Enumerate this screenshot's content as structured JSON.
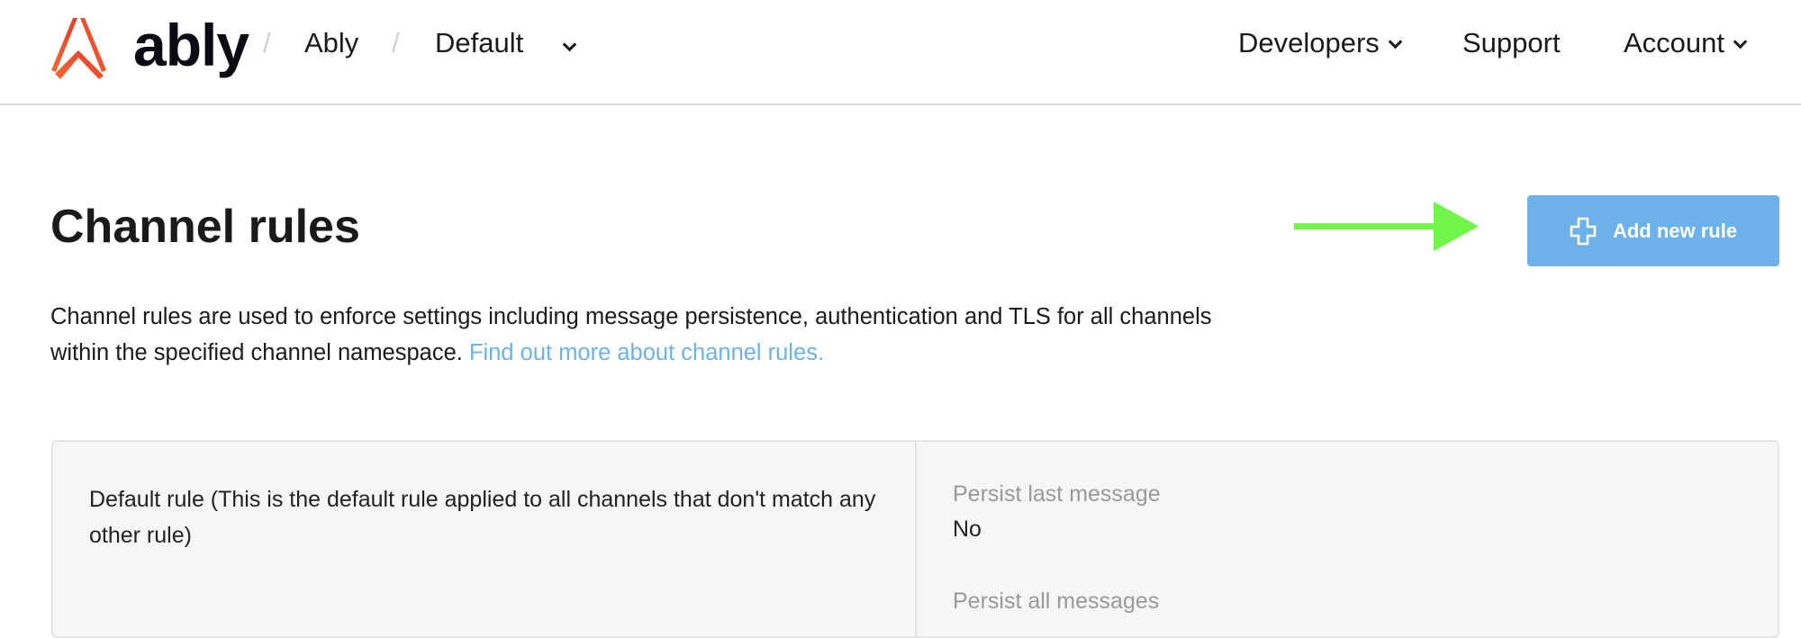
{
  "header": {
    "logo_text": "ably",
    "breadcrumb": [
      "Ably",
      "Default"
    ],
    "nav": {
      "developers": "Developers",
      "support": "Support",
      "account": "Account"
    }
  },
  "page": {
    "title": "Channel rules",
    "add_button": "Add new rule",
    "description": "Channel rules are used to enforce settings including message persistence, authentication and TLS for all channels within the specified channel namespace.",
    "description_link": "Find out more about channel rules."
  },
  "rule": {
    "name": "Default rule (This is the default rule applied to all channels that don't match any other rule)",
    "settings": [
      {
        "label": "Persist last message",
        "value": "No"
      },
      {
        "label": "Persist all messages"
      }
    ]
  },
  "colors": {
    "accent": "#6db1eb",
    "brand": "#ee4c2c",
    "annotation_arrow": "#72f54a"
  }
}
